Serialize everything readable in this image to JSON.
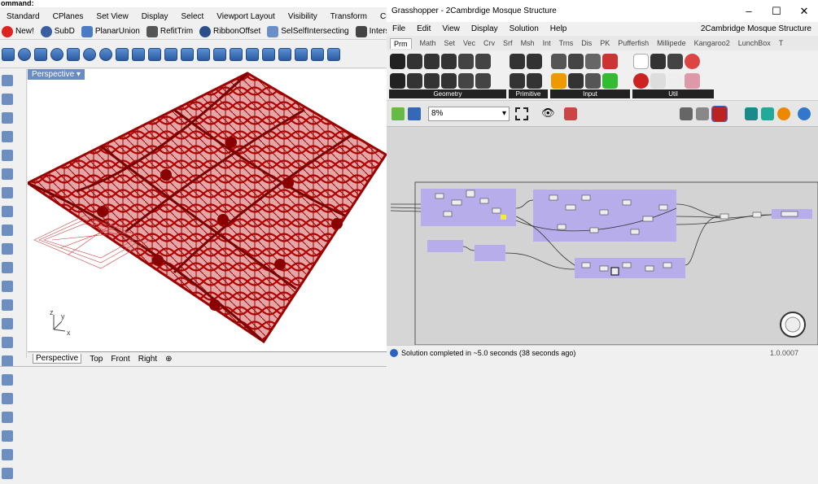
{
  "rhino": {
    "command_label": "ommand:",
    "menu": [
      "Standard",
      "CPlanes",
      "Set View",
      "Display",
      "Select",
      "Viewport Layout",
      "Visibility",
      "Transform",
      "Curve Tools"
    ],
    "toolbar_tabs": [
      {
        "label": "New!",
        "icon": "new-icon"
      },
      {
        "label": "SubD",
        "icon": "subd-icon"
      },
      {
        "label": "PlanarUnion",
        "icon": "planar-union-icon"
      },
      {
        "label": "RefitTrim",
        "icon": "refit-trim-icon"
      },
      {
        "label": "RibbonOffset",
        "icon": "ribbon-offset-icon"
      },
      {
        "label": "SelSelfIntersecting",
        "icon": "sel-self-icon"
      },
      {
        "label": "Interse",
        "icon": "intersect-icon"
      }
    ],
    "viewport_label": "Perspective",
    "viewport_tabs": [
      "Perspective",
      "Top",
      "Front",
      "Right"
    ],
    "axis": {
      "x": "x",
      "y": "y",
      "z": "z"
    },
    "model_color": "#b30000"
  },
  "grasshopper": {
    "title": "Grasshopper - 2Cambrdige Mosque Structure",
    "doc_name": "2Cambridge Mosque Structure",
    "menu": [
      "File",
      "Edit",
      "View",
      "Display",
      "Solution",
      "Help"
    ],
    "tabs": [
      "Prm",
      "Math",
      "Set",
      "Vec",
      "Crv",
      "Srf",
      "Msh",
      "Int",
      "Trns",
      "Dis",
      "PK",
      "Pufferfish",
      "Millipede",
      "Kangaroo2",
      "LunchBox",
      "T"
    ],
    "groups": [
      "Geometry",
      "Primitive",
      "Input",
      "Util"
    ],
    "zoom": "8%",
    "status": "Solution completed in ~5.0 seconds (38 seconds ago)",
    "version": "1.0.0007",
    "group_color": "#b3a6ef"
  }
}
